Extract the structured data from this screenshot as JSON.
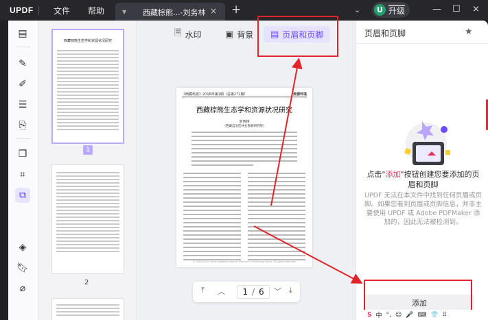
{
  "titlebar": {
    "logo": "UPDF",
    "menu": [
      "文件",
      "帮助"
    ],
    "tab_title": "西藏棕熊...-刘务林",
    "tab_close": "×",
    "tab_add": "+",
    "chevron": "⌄",
    "avatar_letter": "U",
    "upgrade_label": "升级",
    "window_controls": [
      "—",
      "☐",
      "×"
    ]
  },
  "viewer": {
    "tools": [
      {
        "label": "水印",
        "icon": "watermark-icon"
      },
      {
        "label": "背景",
        "icon": "background-icon"
      },
      {
        "label": "页眉和页脚",
        "icon": "header-footer-icon"
      }
    ],
    "page": {
      "header_left": "《西藏科技》2016年第1期（总第271期）",
      "header_right": "资源环境",
      "title": "西藏棕熊生态学和资源状况研究",
      "author": "刘务林",
      "affiliation": "(西藏自治区林业勘察研究院)",
      "footer": "© 1994-2015 China Academic Journal Electronic Publishing House. All rights reserved."
    },
    "pager": {
      "current": "1",
      "divider": "/",
      "total": "6"
    }
  },
  "thumbnails": {
    "items": [
      {
        "page": "1",
        "title": "西藏棕熊生态学和资源状况研究"
      },
      {
        "page": "2"
      }
    ]
  },
  "right_panel": {
    "title": "页眉和页脚",
    "message_pre": "点击\"",
    "message_hl": "添加",
    "message_post": "\"按钮创建您要添加的页眉和页脚",
    "note": "UPDF 无法在本文件中找到任何页眉或页脚。如果您看到页眉或页脚信息，并非主要使用 UPDF 或 Adobe PDFMaker 添加的，因此无法被检测到。",
    "add_button": "添加"
  },
  "ime": {
    "s": "S",
    "items": [
      "中",
      "°,",
      "☺",
      "🎤",
      "⌨",
      "👕",
      "⠿"
    ]
  },
  "colors": {
    "accent": "#6d4cff",
    "annotation_red": "#e2232a",
    "highlight": "#e4315a"
  }
}
